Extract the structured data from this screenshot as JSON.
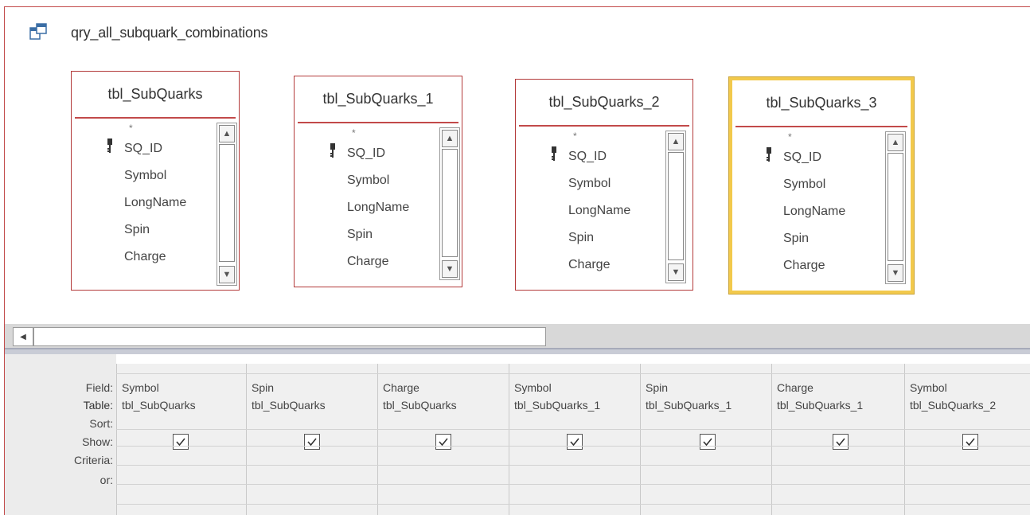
{
  "window": {
    "title": "qry_all_subquark_combinations",
    "title_icon": "query-icon"
  },
  "tables": [
    {
      "name": "tbl_SubQuarks",
      "star": "*",
      "fields": [
        "SQ_ID",
        "Symbol",
        "LongName",
        "Spin",
        "Charge"
      ],
      "selected": false
    },
    {
      "name": "tbl_SubQuarks_1",
      "star": "*",
      "fields": [
        "SQ_ID",
        "Symbol",
        "LongName",
        "Spin",
        "Charge"
      ],
      "selected": false
    },
    {
      "name": "tbl_SubQuarks_2",
      "star": "*",
      "fields": [
        "SQ_ID",
        "Symbol",
        "LongName",
        "Spin",
        "Charge"
      ],
      "selected": false
    },
    {
      "name": "tbl_SubQuarks_3",
      "star": "*",
      "fields": [
        "SQ_ID",
        "Symbol",
        "LongName",
        "Spin",
        "Charge"
      ],
      "selected": true
    }
  ],
  "grid": {
    "row_labels": {
      "field": "Field:",
      "table": "Table:",
      "sort": "Sort:",
      "show": "Show:",
      "criteria": "Criteria:",
      "or": "or:"
    },
    "columns": [
      {
        "field": "Symbol",
        "table": "tbl_SubQuarks",
        "show": true
      },
      {
        "field": "Spin",
        "table": "tbl_SubQuarks",
        "show": true
      },
      {
        "field": "Charge",
        "table": "tbl_SubQuarks",
        "show": true
      },
      {
        "field": "Symbol",
        "table": "tbl_SubQuarks_1",
        "show": true
      },
      {
        "field": "Spin",
        "table": "tbl_SubQuarks_1",
        "show": true
      },
      {
        "field": "Charge",
        "table": "tbl_SubQuarks_1",
        "show": true
      },
      {
        "field": "Symbol",
        "table": "tbl_SubQuarks_2",
        "show": true
      }
    ]
  },
  "colors": {
    "table_border": "#b33a3a",
    "selected_border": "#f2c94c"
  }
}
